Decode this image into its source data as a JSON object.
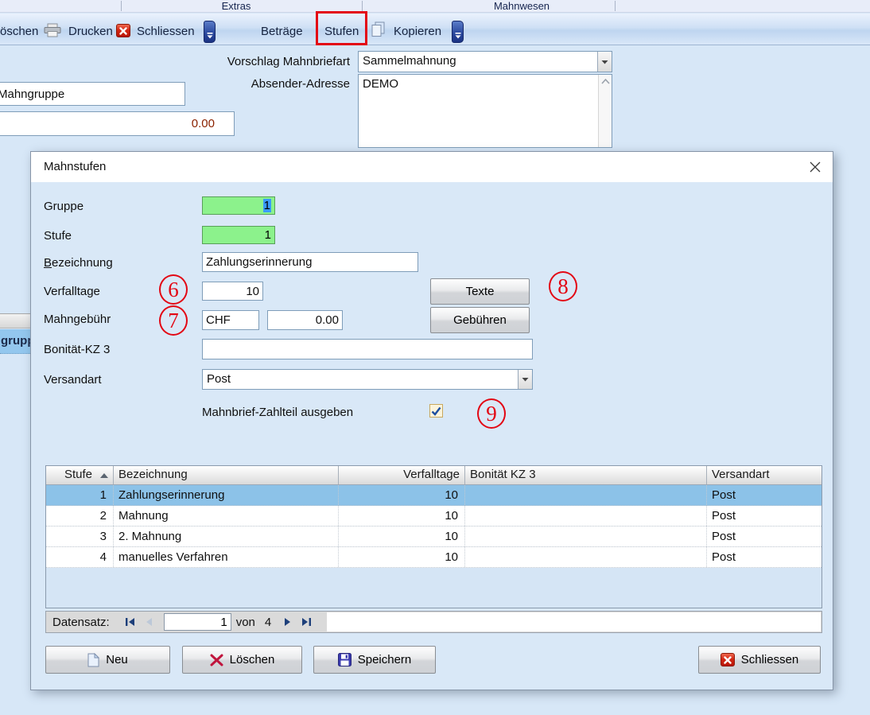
{
  "menubar": {
    "items": [
      "Extras",
      "Mahnwesen"
    ]
  },
  "toolbar": {
    "delete_label": "öschen",
    "print_label": "Drucken",
    "close_label": "Schliessen",
    "amounts_label": "Beträge",
    "levels_label": "Stufen",
    "copy_label": "Kopieren"
  },
  "background_form": {
    "mahnbriefart_label": "Vorschlag Mahnbriefart",
    "mahnbriefart_value": "Sammelmahnung",
    "absender_label": "Absender-Adresse",
    "absender_value": "DEMO",
    "mahngruppe_value": "Mahngruppe",
    "amount_value": "0.00",
    "partial_column_label": "grupp"
  },
  "dialog": {
    "title": "Mahnstufen",
    "fields": {
      "gruppe_label": "Gruppe",
      "gruppe_value": "1",
      "stufe_label": "Stufe",
      "stufe_value": "1",
      "bezeichnung_label_first": "B",
      "bezeichnung_label_rest": "ezeichnung",
      "bezeichnung_value": "Zahlungserinnerung",
      "verfalltage_label": "Verfalltage",
      "verfalltage_value": "10",
      "mahngebuehr_label": "Mahngebühr",
      "currency_value": "CHF",
      "fee_value": "0.00",
      "bonitaet_label": "Bonität-KZ 3",
      "bonitaet_value": "",
      "versandart_label": "Versandart",
      "versandart_value": "Post",
      "zahlteil_label": "Mahnbrief-Zahlteil ausgeben"
    },
    "buttons": {
      "texte": "Texte",
      "gebuehren": "Gebühren",
      "neu": "Neu",
      "loeschen": "Löschen",
      "speichern": "Speichern",
      "schliessen": "Schliessen"
    },
    "table": {
      "columns": [
        "Stufe",
        "Bezeichnung",
        "Verfalltage",
        "Bonität KZ 3",
        "Versandart"
      ],
      "rows": [
        {
          "stufe": "1",
          "bezeichnung": "Zahlungserinnerung",
          "verfalltage": "10",
          "bonitaet": "",
          "versandart": "Post"
        },
        {
          "stufe": "2",
          "bezeichnung": "Mahnung",
          "verfalltage": "10",
          "bonitaet": "",
          "versandart": "Post"
        },
        {
          "stufe": "3",
          "bezeichnung": "2. Mahnung",
          "verfalltage": "10",
          "bonitaet": "",
          "versandart": "Post"
        },
        {
          "stufe": "4",
          "bezeichnung": "manuelles Verfahren",
          "verfalltage": "10",
          "bonitaet": "",
          "versandart": "Post"
        }
      ]
    },
    "navigator": {
      "label": "Datensatz:",
      "current": "1",
      "of_label": "von",
      "total": "4"
    }
  },
  "annotations": {
    "numbers": [
      "6",
      "7",
      "8",
      "9"
    ],
    "highlight_target": "Stufen",
    "color": "#e30613"
  },
  "colors": {
    "annotation_red": "#e30613",
    "field_green": "#8cf28c",
    "selection_blue": "#3a9bfa",
    "selected_row_blue": "#8cc2e8",
    "dialog_body": "#d9e8f7",
    "close_icon_red": "#d42714"
  }
}
